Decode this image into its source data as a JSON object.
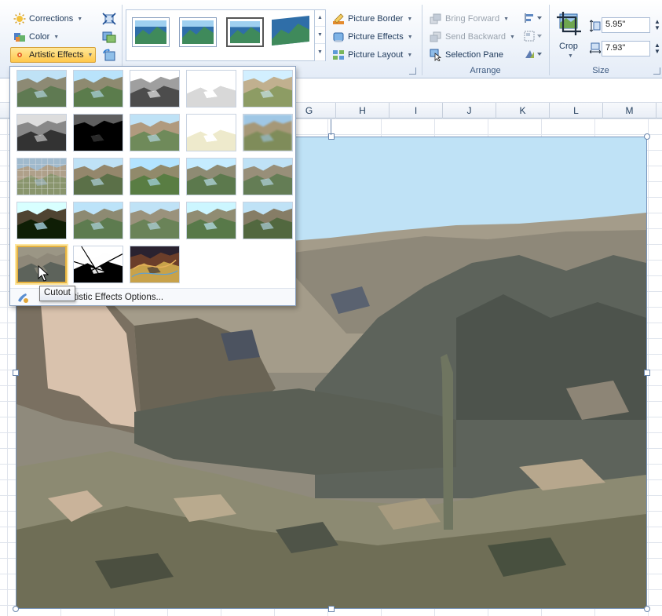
{
  "ribbon": {
    "adjust": {
      "corrections": "Corrections",
      "color": "Color",
      "artistic_effects": "Artistic Effects"
    },
    "picture_styles": {
      "picture_border": "Picture Border",
      "picture_effects": "Picture Effects",
      "picture_layout": "Picture Layout"
    },
    "arrange": {
      "bring_forward": "Bring Forward",
      "send_backward": "Send Backward",
      "selection_pane": "Selection Pane",
      "group_label": "Arrange"
    },
    "size": {
      "crop": "Crop",
      "height": "5.95\"",
      "width": "7.93\"",
      "group_label": "Size"
    }
  },
  "columns": [
    "G",
    "H",
    "I",
    "J",
    "K",
    "L",
    "M"
  ],
  "artistic_effects_menu": {
    "options_label": "Artistic Effects Options...",
    "tooltip": "Cutout",
    "selected_effect": "Cutout"
  },
  "colors": {
    "ribbon_highlight": "#ffc74a",
    "selection_border": "#e7b340",
    "sky": "#bfe2f6",
    "mountain_far": "#a49c8a",
    "mountain_shadow": "#5d635b",
    "rock_light": "#d9c2ad"
  }
}
